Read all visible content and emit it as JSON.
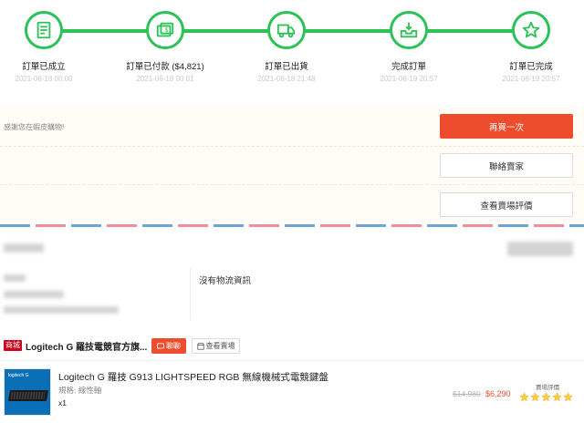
{
  "steps": [
    {
      "label": "訂單已成立",
      "time": "2021-06-18 00:00",
      "icon": "receipt-icon"
    },
    {
      "label": "訂單已付款 ($4,821)",
      "time": "2021-06-18 00:01",
      "icon": "payment-icon"
    },
    {
      "label": "訂單已出貨",
      "time": "2021-06-18 21:48",
      "icon": "truck-icon"
    },
    {
      "label": "完成訂單",
      "time": "2021-06-19 20:57",
      "icon": "inbox-download-icon"
    },
    {
      "label": "訂單已完成",
      "time": "2021-06-19 20:57",
      "icon": "star-icon"
    }
  ],
  "actions": {
    "thanks": "感謝您在蝦皮購物!",
    "buy_again": "再買一次",
    "contact_seller": "聯絡賣家",
    "view_rating": "查看賣場評價"
  },
  "address": {
    "no_logistics": "沒有物流資訊"
  },
  "shop": {
    "badge": "商城",
    "name": "Logitech G 羅技電競官方旗...",
    "chat": "聊聊",
    "view_shop": "查看賣場"
  },
  "product": {
    "name": "Logitech G 羅技 G913 LIGHTSPEED RGB 無線機械式電競鍵盤",
    "variant": "規格: 線性軸",
    "qty": "x1",
    "original_price": "$14,980",
    "price": "$6,290",
    "rating_label": "賣場評價",
    "stars": 5,
    "thumb_logo": "logitech G"
  },
  "colors": {
    "accent": "#ee4d2d",
    "progress": "#2dc258",
    "star": "#ffce3d",
    "stripe_blue": "#6fa6d6",
    "stripe_pink": "#f18d9b"
  }
}
